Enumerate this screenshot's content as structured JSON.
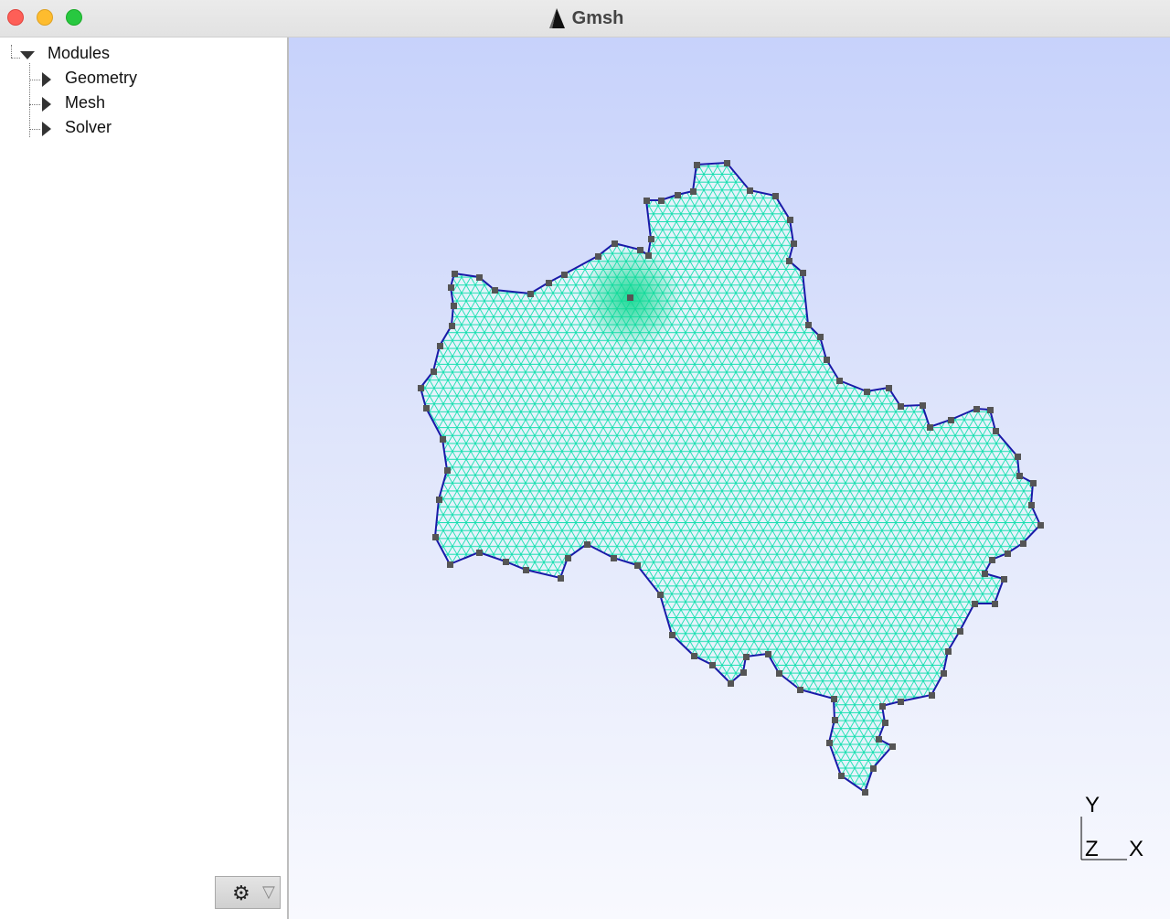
{
  "window": {
    "title": "Gmsh"
  },
  "sidebar": {
    "root": {
      "label": "Modules"
    },
    "items": [
      {
        "label": "Geometry"
      },
      {
        "label": "Mesh"
      },
      {
        "label": "Solver"
      }
    ]
  },
  "viewport": {
    "axes": {
      "y": "Y",
      "z": "Z",
      "x": "X"
    },
    "mesh_color": "#16e0b0",
    "boundary_color": "#1a1aa8",
    "point_color": "#555555"
  },
  "icons": {
    "settings": "gear-icon",
    "menu": "dropdown-triangle-icon"
  }
}
